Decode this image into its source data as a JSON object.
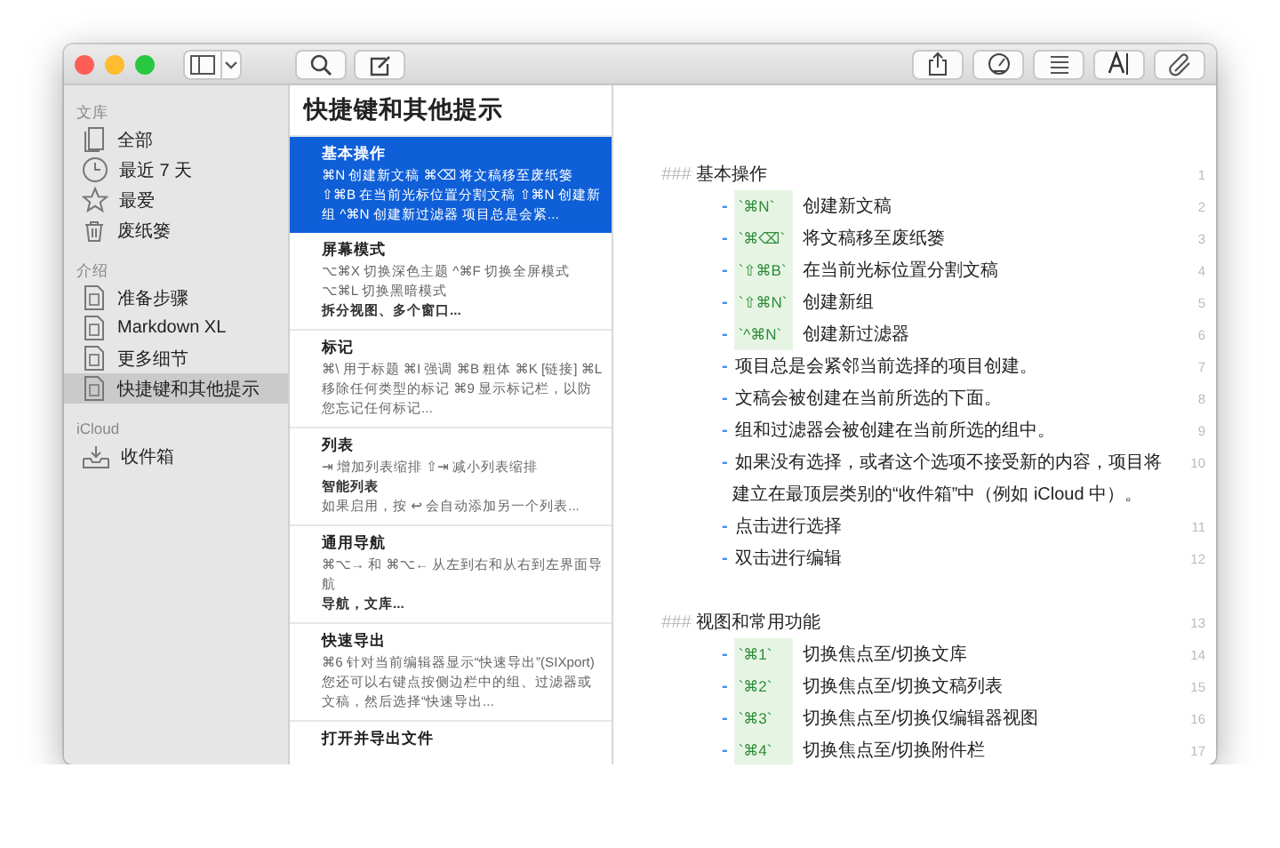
{
  "sidebar": {
    "sections": [
      {
        "header": "文库",
        "items": [
          {
            "label": "全部",
            "selected": false
          },
          {
            "label": "最近 7 天",
            "selected": false
          },
          {
            "label": "最爱",
            "selected": false
          },
          {
            "label": "废纸篓",
            "selected": false
          }
        ]
      },
      {
        "header": "介绍",
        "items": [
          {
            "label": "准备步骤",
            "selected": false
          },
          {
            "label": "Markdown XL",
            "selected": false
          },
          {
            "label": "更多细节",
            "selected": false
          },
          {
            "label": "快捷键和其他提示",
            "selected": true
          }
        ]
      },
      {
        "header": "iCloud",
        "items": [
          {
            "label": "收件箱",
            "selected": false
          }
        ]
      }
    ]
  },
  "note_list": {
    "title": "快捷键和其他提示",
    "notes": [
      {
        "selected": true,
        "parts": [
          {
            "kind": "title",
            "text": "基本操作"
          },
          {
            "kind": "text",
            "text": "⌘N 创建新文稿 ⌘⌫ 将文稿移至废纸篓 ⇧⌘B 在当前光标位置分割文稿 ⇧⌘N 创建新组 ^⌘N 创建新过滤器 项目总是会紧..."
          }
        ]
      },
      {
        "selected": false,
        "parts": [
          {
            "kind": "title",
            "text": "屏幕模式"
          },
          {
            "kind": "text",
            "text": "⌥⌘X 切换深色主题 ^⌘F 切换全屏模式 ⌥⌘L 切换黑暗模式"
          },
          {
            "kind": "bold",
            "text": "拆分视图、多个窗口..."
          }
        ]
      },
      {
        "selected": false,
        "parts": [
          {
            "kind": "title",
            "text": "标记"
          },
          {
            "kind": "text",
            "text": "⌘\\ 用于标题 ⌘I 强调 ⌘B 粗体 ⌘K [链接] ⌘L 移除任何类型的标记 ⌘9 显示标记栏，以防您忘记任何标记..."
          }
        ]
      },
      {
        "selected": false,
        "parts": [
          {
            "kind": "title",
            "text": "列表"
          },
          {
            "kind": "text",
            "text": "⇥ 增加列表缩排 ⇧⇥ 减小列表缩排"
          },
          {
            "kind": "bold",
            "text": "智能列表"
          },
          {
            "kind": "text",
            "text": "如果启用，按 ↩ 会自动添加另一个列表..."
          }
        ]
      },
      {
        "selected": false,
        "parts": [
          {
            "kind": "title",
            "text": "通用导航"
          },
          {
            "kind": "text",
            "text": "⌘⌥→ 和 ⌘⌥← 从左到右和从右到左界面导航"
          },
          {
            "kind": "bold",
            "text": "导航，文库..."
          }
        ]
      },
      {
        "selected": false,
        "parts": [
          {
            "kind": "title",
            "text": "快速导出"
          },
          {
            "kind": "text",
            "text": "⌘6 针对当前编辑器显示“快速导出”(SIXport) 您还可以右键点按侧边栏中的组、过滤器或文稿，然后选择“快速导出..."
          }
        ]
      },
      {
        "selected": false,
        "parts": [
          {
            "kind": "title",
            "text": "打开并导出文件"
          }
        ]
      }
    ]
  },
  "editor": {
    "lines": [
      {
        "kind": "heading",
        "marker": "###",
        "text": "基本操作",
        "number": "1"
      },
      {
        "kind": "key",
        "bullet": "-",
        "key": "`⌘N`",
        "text": "创建新文稿",
        "number": "2"
      },
      {
        "kind": "key",
        "bullet": "-",
        "key": "`⌘⌫`",
        "text": "将文稿移至废纸篓",
        "number": "3"
      },
      {
        "kind": "key",
        "bullet": "-",
        "key": "`⇧⌘B`",
        "text": "在当前光标位置分割文稿",
        "number": "4"
      },
      {
        "kind": "key",
        "bullet": "-",
        "key": "`⇧⌘N`",
        "text": "创建新组",
        "number": "5"
      },
      {
        "kind": "key",
        "bullet": "-",
        "key": "`^⌘N`",
        "text": "创建新过滤器",
        "number": "6"
      },
      {
        "kind": "item",
        "bullet": "-",
        "text": "项目总是会紧邻当前选择的项目创建。",
        "number": "7"
      },
      {
        "kind": "item",
        "bullet": "-",
        "text": "文稿会被创建在当前所选的下面。",
        "number": "8"
      },
      {
        "kind": "item",
        "bullet": "-",
        "text": "组和过滤器会被创建在当前所选的组中。",
        "number": "9"
      },
      {
        "kind": "item",
        "bullet": "-",
        "text": "如果没有选择，或者这个选项不接受新的内容，项目将",
        "number": "10"
      },
      {
        "kind": "continuation",
        "text": "建立在最顶层类别的“收件箱”中（例如 iCloud 中）。"
      },
      {
        "kind": "item",
        "bullet": "-",
        "text": "点击进行选择",
        "number": "11"
      },
      {
        "kind": "item",
        "bullet": "-",
        "text": "双击进行编辑",
        "number": "12"
      },
      {
        "kind": "blank"
      },
      {
        "kind": "heading",
        "marker": "###",
        "text": "视图和常用功能",
        "number": "13"
      },
      {
        "kind": "key",
        "bullet": "-",
        "key": "`⌘1`",
        "text": "切换焦点至/切换文库",
        "number": "14"
      },
      {
        "kind": "key",
        "bullet": "-",
        "key": "`⌘2`",
        "text": "切换焦点至/切换文稿列表",
        "number": "15"
      },
      {
        "kind": "key",
        "bullet": "-",
        "key": "`⌘3`",
        "text": "切换焦点至/切换仅编辑器视图",
        "number": "16"
      },
      {
        "kind": "key",
        "bullet": "-",
        "key": "`⌘4`",
        "text": "切换焦点至/切换附件栏",
        "number": "17"
      }
    ]
  }
}
